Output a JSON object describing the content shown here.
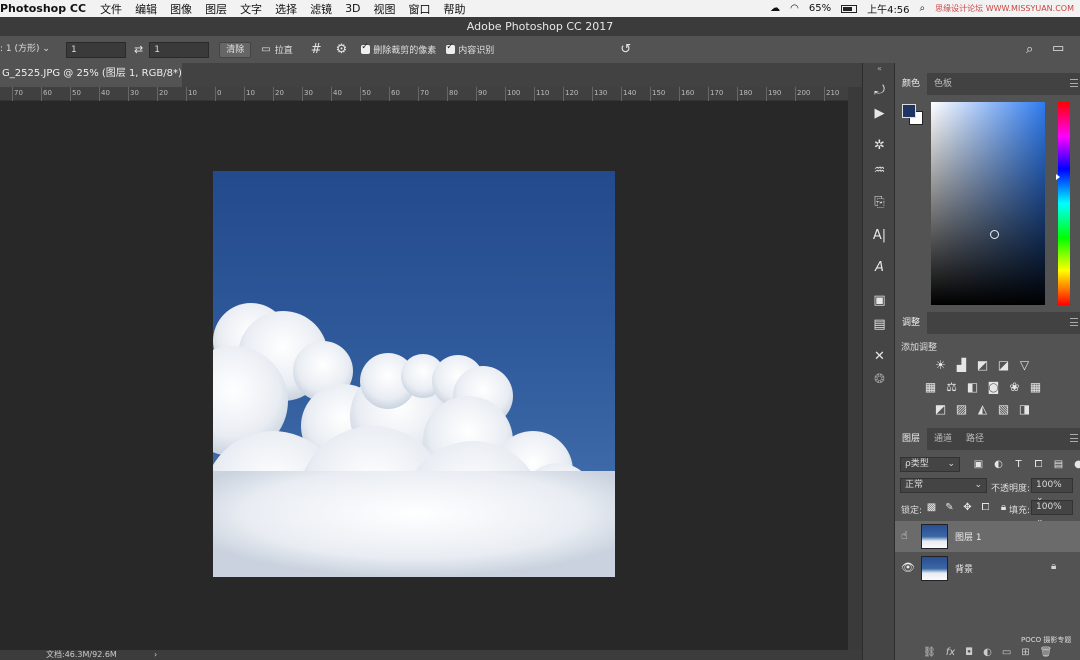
{
  "menubar": {
    "app": "Photoshop CC",
    "items": [
      "文件",
      "编辑",
      "图像",
      "图层",
      "文字",
      "选择",
      "滤镜",
      "3D",
      "视图",
      "窗口",
      "帮助"
    ],
    "battery": "65%",
    "time": "上午4:56",
    "watermark": "思缘设计论坛 WWW.MISSYUAN.COM"
  },
  "titlebar": {
    "title": "Adobe Photoshop CC 2017"
  },
  "options": {
    "ratio_label": ": 1 (方形)",
    "ratio_value_1": "1",
    "ratio_value_2": "1",
    "clear_label": "清除",
    "straighten_label": "拉直",
    "delete_cropped_label": "删除裁剪的像素",
    "content_aware_label": "内容识别"
  },
  "document": {
    "tab_title": "G_2525.JPG @ 25% (图层 1, RGB/8*) *",
    "ruler_ticks": [
      "70",
      "60",
      "50",
      "40",
      "30",
      "20",
      "10",
      "0",
      "10",
      "20",
      "30",
      "40",
      "50",
      "60",
      "70",
      "80",
      "90",
      "100",
      "110",
      "120",
      "130",
      "140",
      "150",
      "160",
      "170",
      "180",
      "190",
      "200",
      "210",
      "22"
    ],
    "status": "文档:46.3M/92.6M"
  },
  "panels": {
    "color_tabs": [
      "颜色",
      "色板"
    ],
    "adjust_tab": "调整",
    "adjust_add": "添加调整",
    "layer_tabs": [
      "图层",
      "通道",
      "路径"
    ],
    "filter_kind": "ρ类型",
    "blend_mode": "正常",
    "opacity_label": "不透明度:",
    "opacity_value": "100%",
    "lock_label": "锁定:",
    "fill_label": "填充:",
    "fill_value": "100%",
    "layers": [
      {
        "name": "图层 1",
        "selected": true
      },
      {
        "name": "背景",
        "locked": true
      }
    ],
    "footer_watermark": "POCO 摄影专题"
  }
}
